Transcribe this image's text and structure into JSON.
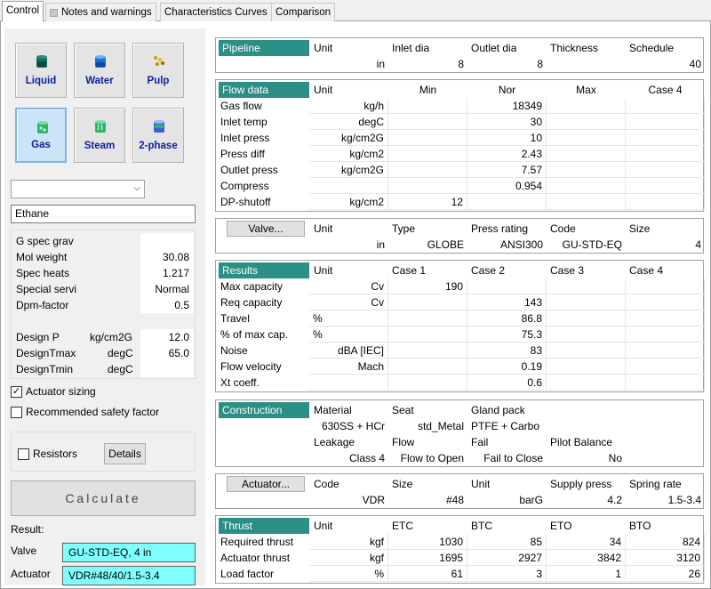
{
  "tabs": {
    "control": "Control",
    "notes": "Notes and warnings",
    "curves": "Characteristics Curves",
    "comparison": "Comparison"
  },
  "fluid_buttons": {
    "liquid": "Liquid",
    "water": "Water",
    "pulp": "Pulp",
    "gas": "Gas",
    "steam": "Steam",
    "two_phase": "2-phase"
  },
  "fluid_name": "Ethane",
  "props": {
    "gspec_label": "G spec grav",
    "gspec_value": "",
    "molw_label": "Mol weight",
    "molw_value": "30.08",
    "spech_label": "Spec heats",
    "spech_value": "1.217",
    "special_label": "Special servi",
    "special_value": "Normal",
    "dpm_label": "Dpm-factor",
    "dpm_value": "0.5"
  },
  "design": {
    "p_label": "Design P",
    "p_unit": "kg/cm2G",
    "p_value": "12.0",
    "tmax_label": "DesignTmax",
    "tmax_unit": "degC",
    "tmax_value": "65.0",
    "tmin_label": "DesignTmin",
    "tmin_unit": "degC",
    "tmin_value": ""
  },
  "options": {
    "actuator_sizing": "Actuator sizing",
    "actuator_checked": "✓",
    "safety_factor": "Recommended safety factor",
    "resistors": "Resistors",
    "details": "Details"
  },
  "calculate": "Calculate",
  "result": {
    "label": "Result:",
    "valve_label": "Valve",
    "valve_value": "GU-STD-EQ, 4 in",
    "actuator_label": "Actuator",
    "actuator_value": "VDR#48/40/1.5-3.4"
  },
  "pipeline": {
    "title": "Pipeline",
    "headers": [
      "Unit",
      "Inlet dia",
      "Outlet dia",
      "Thickness",
      "Schedule"
    ],
    "values": [
      "in",
      "8",
      "8",
      "",
      "40"
    ]
  },
  "flow": {
    "title": "Flow data",
    "headers": [
      "Unit",
      "Min",
      "Nor",
      "Max",
      "Case 4"
    ],
    "rows": [
      [
        "Gas flow",
        "kg/h",
        "",
        "18349",
        "",
        ""
      ],
      [
        "Inlet temp",
        "degC",
        "",
        "30",
        "",
        ""
      ],
      [
        "Inlet press",
        "kg/cm2G",
        "",
        "10",
        "",
        ""
      ],
      [
        "Press diff",
        "kg/cm2",
        "",
        "2.43",
        "",
        ""
      ],
      [
        "Outlet press",
        "kg/cm2G",
        "",
        "7.57",
        "",
        ""
      ],
      [
        "Compress",
        "",
        "",
        "0.954",
        "",
        ""
      ],
      [
        "DP-shutoff",
        "kg/cm2",
        "12",
        "",
        "",
        ""
      ]
    ]
  },
  "valve": {
    "button": "Valve...",
    "headers": [
      "Unit",
      "Type",
      "Press rating",
      "Code",
      "Size"
    ],
    "values": [
      "in",
      "GLOBE",
      "ANSI300",
      "GU-STD-EQ",
      "4"
    ]
  },
  "results": {
    "title": "Results",
    "headers": [
      "Unit",
      "Case 1",
      "Case 2",
      "Case 3",
      "Case 4"
    ],
    "rows": [
      [
        "Max capacity",
        "Cv",
        "190",
        "",
        "",
        ""
      ],
      [
        "Req capacity",
        "Cv",
        "",
        "143",
        "",
        ""
      ],
      [
        "Travel",
        "%",
        "",
        "86.8",
        "",
        ""
      ],
      [
        "% of max cap.",
        "%",
        "",
        "75.3",
        "",
        ""
      ],
      [
        "Noise",
        "dBA [IEC]",
        "",
        "83",
        "",
        ""
      ],
      [
        "Flow velocity",
        "Mach",
        "",
        "0.19",
        "",
        ""
      ],
      [
        "Xt coeff.",
        "",
        "",
        "0.6",
        "",
        ""
      ]
    ]
  },
  "construction": {
    "title": "Construction",
    "headers1": [
      "Material",
      "Seat",
      "Gland pack"
    ],
    "values1": [
      "630SS + HCr",
      "std_Metal",
      "PTFE + Carbo"
    ],
    "headers2": [
      "Leakage",
      "Flow",
      "Fail",
      "Pilot Balance"
    ],
    "values2": [
      "Class 4",
      "Flow to Open",
      "Fail to Close",
      "No"
    ]
  },
  "actuator": {
    "button": "Actuator...",
    "headers": [
      "Code",
      "Size",
      "Unit",
      "Supply press",
      "Spring rate"
    ],
    "values": [
      "VDR",
      "#48",
      "barG",
      "4.2",
      "1.5-3.4"
    ]
  },
  "thrust": {
    "title": "Thrust",
    "headers": [
      "Unit",
      "ETC",
      "BTC",
      "ETO",
      "BTO"
    ],
    "rows": [
      [
        "Required thrust",
        "kgf",
        "1030",
        "85",
        "34",
        "824"
      ],
      [
        "Actuator thrust",
        "kgf",
        "1695",
        "2927",
        "3842",
        "3120"
      ],
      [
        "Load factor",
        "%",
        "61",
        "3",
        "1",
        "26"
      ]
    ]
  },
  "colors": {
    "header_bg": "#2a8f84",
    "result_bg": "#80ffff",
    "selected_bg": "#cce4f7"
  },
  "icons": [
    "liquid-tank-icon",
    "water-tank-icon",
    "pulp-icon",
    "gas-tank-icon",
    "steam-tank-icon",
    "two-phase-tank-icon",
    "dropdown-arrow-icon"
  ]
}
